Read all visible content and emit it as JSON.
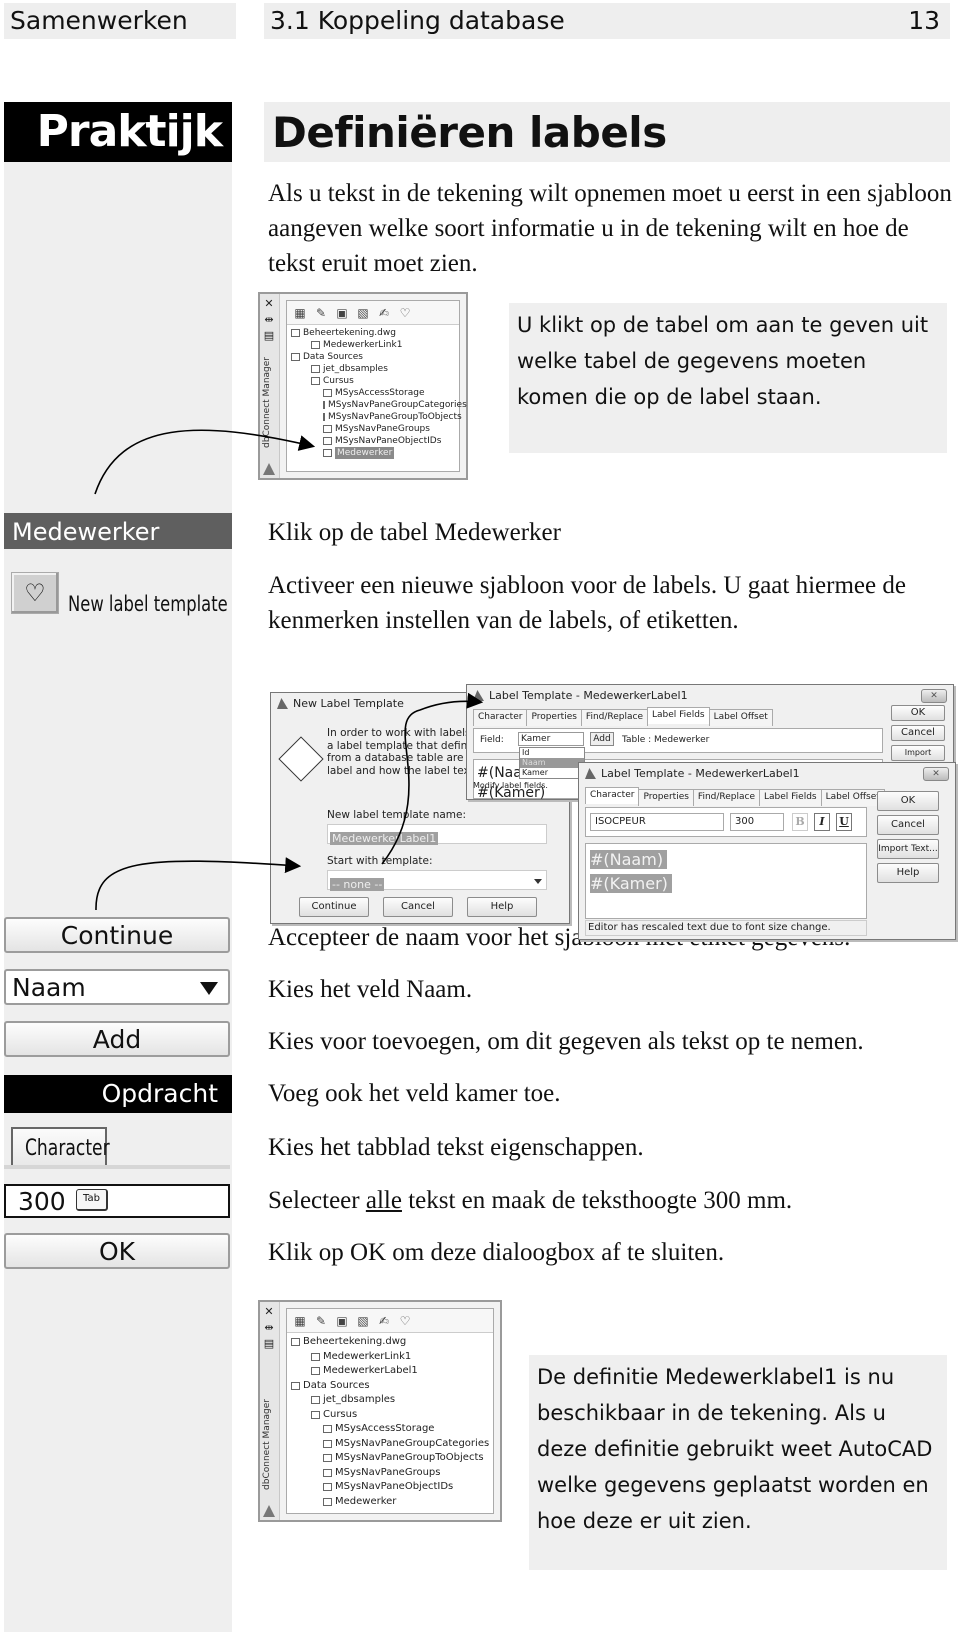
{
  "header": {
    "chapter": "Samenwerken",
    "section": "3.1 Koppeling database",
    "page_number": "13"
  },
  "sidebar_title": "Praktijk",
  "title": "Definiëren labels",
  "intro": "Als u tekst in de tekening wilt opnemen moet u eerst in een sjabloon aangeven welke soort informatie u in de tekening wilt en hoe de tekst eruit moet zien.",
  "callout_1": "U klikt op de tabel om aan te geven uit welke tabel de gegevens moeten komen die op de label staan.",
  "callout_2": "De definitie Medewerklabel1 is nu beschikbaar in de tekening. Als u deze definitie gebruikt weet AutoCAD welke gegevens geplaatst worden en hoe deze er uit zien.",
  "dbconnect_1": {
    "panel_label": "dbConnect Manager",
    "toolbar_icons": [
      "view-table-icon",
      "edit-table-icon",
      "link-icon",
      "link-template-icon",
      "label-template-icon",
      "new-label-template-icon"
    ],
    "tree": [
      {
        "label": "Beheertekening.dwg",
        "level": 0,
        "icon": "drawing-icon"
      },
      {
        "label": "MedewerkerLink1",
        "level": 1,
        "icon": "link-icon"
      },
      {
        "label": "Data Sources",
        "level": 0,
        "icon": "data-sources-icon"
      },
      {
        "label": "jet_dbsamples",
        "level": 1,
        "icon": "datasource-icon"
      },
      {
        "label": "Cursus",
        "level": 1,
        "icon": "database-icon"
      },
      {
        "label": "MSysAccessStorage",
        "level": 2,
        "icon": "table-icon"
      },
      {
        "label": "MSysNavPaneGroupCategories",
        "level": 2,
        "icon": "table-icon"
      },
      {
        "label": "MSysNavPaneGroupToObjects",
        "level": 2,
        "icon": "table-icon"
      },
      {
        "label": "MSysNavPaneGroups",
        "level": 2,
        "icon": "table-icon"
      },
      {
        "label": "MSysNavPaneObjectIDs",
        "level": 2,
        "icon": "table-icon"
      },
      {
        "label": "Medewerker",
        "level": 2,
        "icon": "table-icon",
        "selected": true
      }
    ]
  },
  "dbconnect_2": {
    "panel_label": "dbConnect Manager",
    "tree": [
      {
        "label": "Beheertekening.dwg",
        "level": 0,
        "icon": "drawing-icon"
      },
      {
        "label": "MedewerkerLink1",
        "level": 1,
        "icon": "link-icon"
      },
      {
        "label": "MedewerkerLabel1",
        "level": 1,
        "icon": "label-icon"
      },
      {
        "label": "Data Sources",
        "level": 0,
        "icon": "data-sources-icon"
      },
      {
        "label": "jet_dbsamples",
        "level": 1,
        "icon": "datasource-icon"
      },
      {
        "label": "Cursus",
        "level": 1,
        "icon": "database-icon"
      },
      {
        "label": "MSysAccessStorage",
        "level": 2,
        "icon": "table-icon"
      },
      {
        "label": "MSysNavPaneGroupCategories",
        "level": 2,
        "icon": "table-icon"
      },
      {
        "label": "MSysNavPaneGroupToObjects",
        "level": 2,
        "icon": "table-icon"
      },
      {
        "label": "MSysNavPaneGroups",
        "level": 2,
        "icon": "table-icon"
      },
      {
        "label": "MSysNavPaneObjectIDs",
        "level": 2,
        "icon": "table-icon"
      },
      {
        "label": "Medewerker",
        "level": 2,
        "icon": "table-icon"
      }
    ]
  },
  "left_controls": {
    "medewerker": "Medewerker",
    "new_label_template": "New label template",
    "continue": "Continue",
    "naam": "Naam",
    "add": "Add",
    "opdracht": "Opdracht",
    "character_tab": "Character",
    "size_value": "300",
    "tab_key": "Tab",
    "ok": "OK"
  },
  "steps": {
    "s1": "Klik op de tabel Medewerker",
    "s2": "Activeer een nieuwe sjabloon voor de labels. U gaat hiermee de kenmerken instellen van de labels, of etiketten.",
    "s3": "Accepteer de naam voor het sjabloon met etiket gegevens.",
    "s4": "Kies het veld Naam.",
    "s5": "Kies voor toevoegen, om dit gegeven als tekst op te nemen.",
    "s6": "Voeg ook het veld kamer toe.",
    "s7": "Kies het tabblad tekst eigenschappen.",
    "s8_pre": "Selecteer ",
    "s8_underlined": "alle",
    "s8_post": " tekst en maak de teksthoogte 300 mm.",
    "s9": "Klik op OK om deze dialoogbox af te sluiten."
  },
  "dialog_new": {
    "title": "New Label Template",
    "description": "In order to work with labels, you must create a label template that defines what fields from a database table are displayed in the label and how the label text is formatted.",
    "name_label": "New label template name:",
    "name_value": "MedewerkerLabel1",
    "start_label": "Start with template:",
    "start_value": "-- none --",
    "continue": "Continue",
    "cancel": "Cancel",
    "help": "Help"
  },
  "dialog_lt1": {
    "title": "Label Template - MedewerkerLabel1",
    "tabs": [
      "Character",
      "Properties",
      "Find/Replace",
      "Label Fields",
      "Label Offset"
    ],
    "active_tab": "Label Fields",
    "field_label": "Field:",
    "field_value": "Kamer",
    "field_options": [
      "Id",
      "Naam",
      "Kamer"
    ],
    "field_highlighted": "Naam",
    "add": "Add",
    "table": "Table : Medewerker",
    "editor_lines": [
      "#(Naam)",
      "#(Kamer)"
    ],
    "status": "Modify label fields.",
    "ok": "OK",
    "cancel": "Cancel",
    "import": "Import Text...",
    "close": "✕"
  },
  "dialog_lt2": {
    "title": "Label Template - MedewerkerLabel1",
    "tabs": [
      "Character",
      "Properties",
      "Find/Replace",
      "Label Fields",
      "Label Offset"
    ],
    "active_tab": "Character",
    "font": "ISOCPEUR",
    "size": "300",
    "bold": "B",
    "italic": "I",
    "underline": "U",
    "editor_lines": [
      "#(Naam)",
      "#(Kamer)"
    ],
    "status": "Editor has rescaled text due to font size change.",
    "ok": "OK",
    "cancel": "Cancel",
    "import": "Import Text...",
    "help": "Help",
    "close": "✕"
  }
}
